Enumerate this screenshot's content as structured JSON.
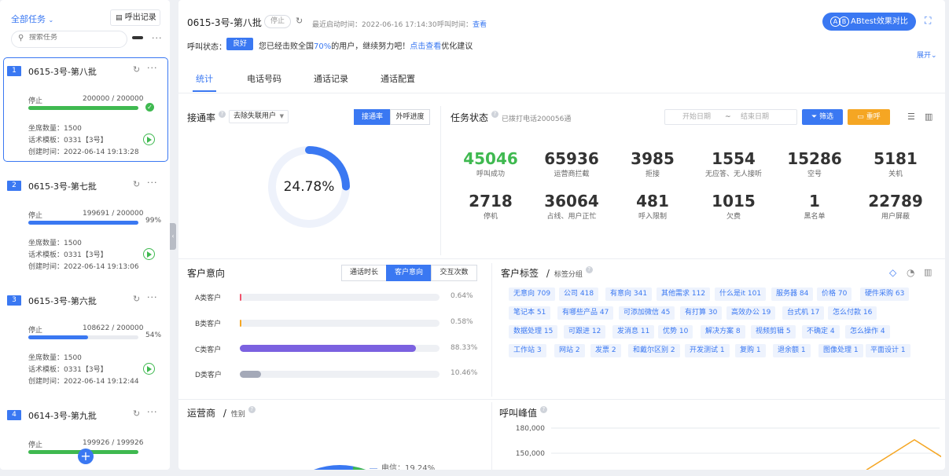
{
  "sidebar": {
    "filter_label": "全部任务",
    "history_label": "呼出记录",
    "search_placeholder": "搜索任务",
    "tasks": [
      {
        "index": "1",
        "name": "0615-3号-第八批",
        "status": "停止",
        "progress": "200000 / 200000",
        "fraction": 1.0,
        "done": "✓",
        "percent": "",
        "seats": "坐席数量：1500",
        "template": "话术模板：0331【3号】",
        "created": "创建时间：2022-06-14 19:13:28"
      },
      {
        "index": "2",
        "name": "0615-3号-第七批",
        "status": "停止",
        "progress": "199691 / 200000",
        "fraction": 0.998,
        "done": "",
        "percent": "99%",
        "seats": "坐席数量：1500",
        "template": "话术模板：0331【3号】",
        "created": "创建时间：2022-06-14 19:13:06"
      },
      {
        "index": "3",
        "name": "0615-3号-第六批",
        "status": "停止",
        "progress": "108622 / 200000",
        "fraction": 0.543,
        "done": "",
        "percent": "54%",
        "seats": "坐席数量：1500",
        "template": "话术模板：0331【3号】",
        "created": "创建时间：2022-06-14 19:12:44"
      },
      {
        "index": "4",
        "name": "0614-3号-第九批",
        "status": "停止",
        "progress": "199926 / 199926",
        "fraction": 1.0,
        "done": "",
        "percent": "",
        "seats": "",
        "template": "",
        "created": ""
      }
    ]
  },
  "header": {
    "title": "0615-3号-第八批",
    "status_badge": "停止",
    "last_start_label": "最近启动时间：",
    "last_start_value": "2022-06-16 17:14:30",
    "call_time_label": "呼叫时间：",
    "call_time_link": "查看",
    "ab_button": "ABtest效果对比",
    "ab_logo_a": "A",
    "ab_logo_b": "B",
    "call_status_label": "呼叫状态：",
    "call_status_badge": "良好",
    "msg_pre": "您已经击败全国",
    "msg_pct": "70%",
    "msg_mid": "的用户，继续努力吧！",
    "msg_link": "点击查看",
    "msg_post": "优化建议",
    "expand": "展开"
  },
  "tabs": [
    "统计",
    "电话号码",
    "通话记录",
    "通话配置"
  ],
  "connect": {
    "title": "接通率",
    "dropdown": "去除失联用户",
    "btn_rate": "接通率",
    "btn_progress": "外呼进度",
    "rate": 0.2478,
    "rate_text": "24.78%"
  },
  "task_status": {
    "title": "任务状态",
    "subtitle": "已拨打电话200056通",
    "start_placeholder": "开始日期",
    "tilde": "~",
    "end_placeholder": "结束日期",
    "filter_btn": "筛选",
    "reset_btn": "重呼",
    "stats": [
      {
        "value": "45046",
        "label": "呼叫成功",
        "color": "#3fb950"
      },
      {
        "value": "65936",
        "label": "运营商拦截",
        "color": "#333333"
      },
      {
        "value": "3985",
        "label": "拒接",
        "color": "#333333"
      },
      {
        "value": "1554",
        "label": "无应答、无人接听",
        "color": "#333333"
      },
      {
        "value": "15286",
        "label": "空号",
        "color": "#333333"
      },
      {
        "value": "5181",
        "label": "关机",
        "color": "#333333"
      },
      {
        "value": "2718",
        "label": "停机",
        "color": "#333333"
      },
      {
        "value": "36064",
        "label": "占线、用户正忙",
        "color": "#333333"
      },
      {
        "value": "481",
        "label": "呼入限制",
        "color": "#333333"
      },
      {
        "value": "1015",
        "label": "欠费",
        "color": "#333333"
      },
      {
        "value": "1",
        "label": "黑名单",
        "color": "#333333"
      },
      {
        "value": "22789",
        "label": "用户屏蔽",
        "color": "#333333"
      }
    ]
  },
  "intent": {
    "title": "客户意向",
    "tabs": [
      "通话时长",
      "客户意向",
      "交互次数"
    ],
    "rows": [
      {
        "label": "A类客户",
        "value": 0.64,
        "text": "0.64%",
        "color": "#f0526b"
      },
      {
        "label": "B类客户",
        "value": 0.58,
        "text": "0.58%",
        "color": "#f5a623"
      },
      {
        "label": "C类客户",
        "value": 88.33,
        "text": "88.33%",
        "color": "#7b61e0"
      },
      {
        "label": "D类客户",
        "value": 10.46,
        "text": "10.46%",
        "color": "#a4a9b8"
      }
    ]
  },
  "tags": {
    "title": "客户标签",
    "sep": "/",
    "subtitle": "标签分组",
    "items": [
      "无意向 709",
      "公司 418",
      "有意向 341",
      "其他需求 112",
      "什么是it 101",
      "服务器 84",
      "价格 70",
      "硬件采购 63",
      "笔记本 51",
      "有哪些产品 47",
      "可添加微信 45",
      "有打算 30",
      "高效办公 19",
      "台式机 17",
      "怎么付款 16",
      "数据处理 15",
      "可跟进 12",
      "发消息 11",
      "优势 10",
      "解决方案 8",
      "视频剪辑 5",
      "不确定 4",
      "怎么操作 4",
      "工作站 3",
      "网站 2",
      "发票 2",
      "和戴尔区别 2",
      "开发测试 1",
      "复购 1",
      "退余额 1",
      "图像处理 1",
      "平面设计 1"
    ]
  },
  "carrier": {
    "title": "运营商",
    "sep": "/",
    "subtitle": "性别",
    "legend": "电信：19.24%"
  },
  "peak": {
    "title": "呼叫峰值",
    "chart_data": {
      "type": "line",
      "y_ticks": [
        "180,000",
        "150,000"
      ],
      "ylim_visible": [
        140000,
        185000
      ],
      "series": [
        {
          "values": [
            130000,
            166000,
            130000
          ]
        }
      ],
      "color": "#f5a623"
    }
  },
  "colors": {
    "accent": "#3a78f2",
    "success": "#3fb950",
    "warning": "#f5a623"
  }
}
